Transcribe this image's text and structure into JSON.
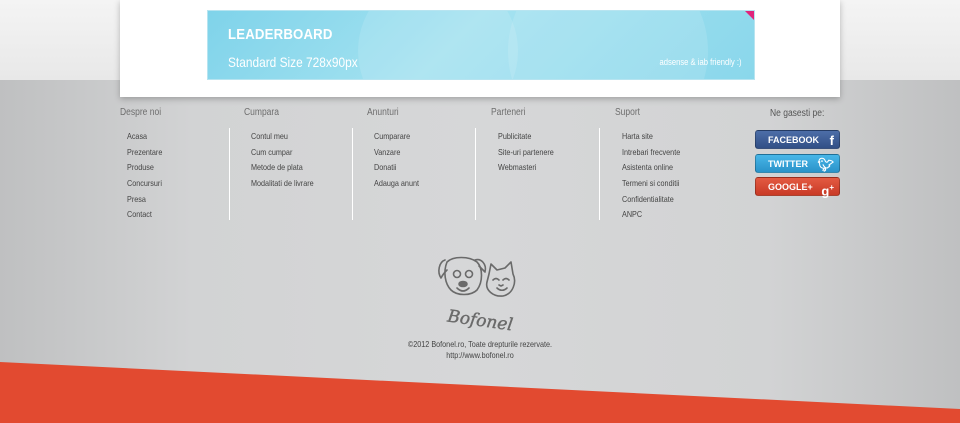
{
  "ad": {
    "title": "LEADERBOARD",
    "size": "Standard Size 728x90px",
    "note": "adsense & iab friendly :)"
  },
  "footer": {
    "columns": [
      {
        "heading": "Despre noi",
        "links": [
          "Acasa",
          "Prezentare",
          "Produse",
          "Concursuri",
          "Presa",
          "Contact"
        ]
      },
      {
        "heading": "Cumpara",
        "links": [
          "Contul meu",
          "Cum cumpar",
          "Metode de plata",
          "Modalitati de livrare"
        ]
      },
      {
        "heading": "Anunturi",
        "links": [
          "Cumparare",
          "Vanzare",
          "Donatii",
          "Adauga anunt"
        ]
      },
      {
        "heading": "Parteneri",
        "links": [
          "Publicitate",
          "Site-uri partenere",
          "Webmasteri"
        ]
      },
      {
        "heading": "Suport",
        "links": [
          "Harta site",
          "Intrebari frecvente",
          "Asistenta online",
          "Termeni si conditii",
          "Confidentialitate",
          "ANPC"
        ]
      }
    ],
    "social": {
      "heading": "Ne gasesti pe:",
      "facebook": "FACEBOOK",
      "twitter": "TWITTER",
      "google": "GOOGLE+"
    },
    "copyright": "©2012 Bofonel.ro, Toate drepturile rezervate.",
    "url": "http://www.bofonel.ro",
    "logo_text": "Bofonel"
  },
  "colors": {
    "accent_red": "#e24a30",
    "facebook": "#3b5998",
    "twitter": "#33a7dd",
    "google": "#d84b34"
  }
}
